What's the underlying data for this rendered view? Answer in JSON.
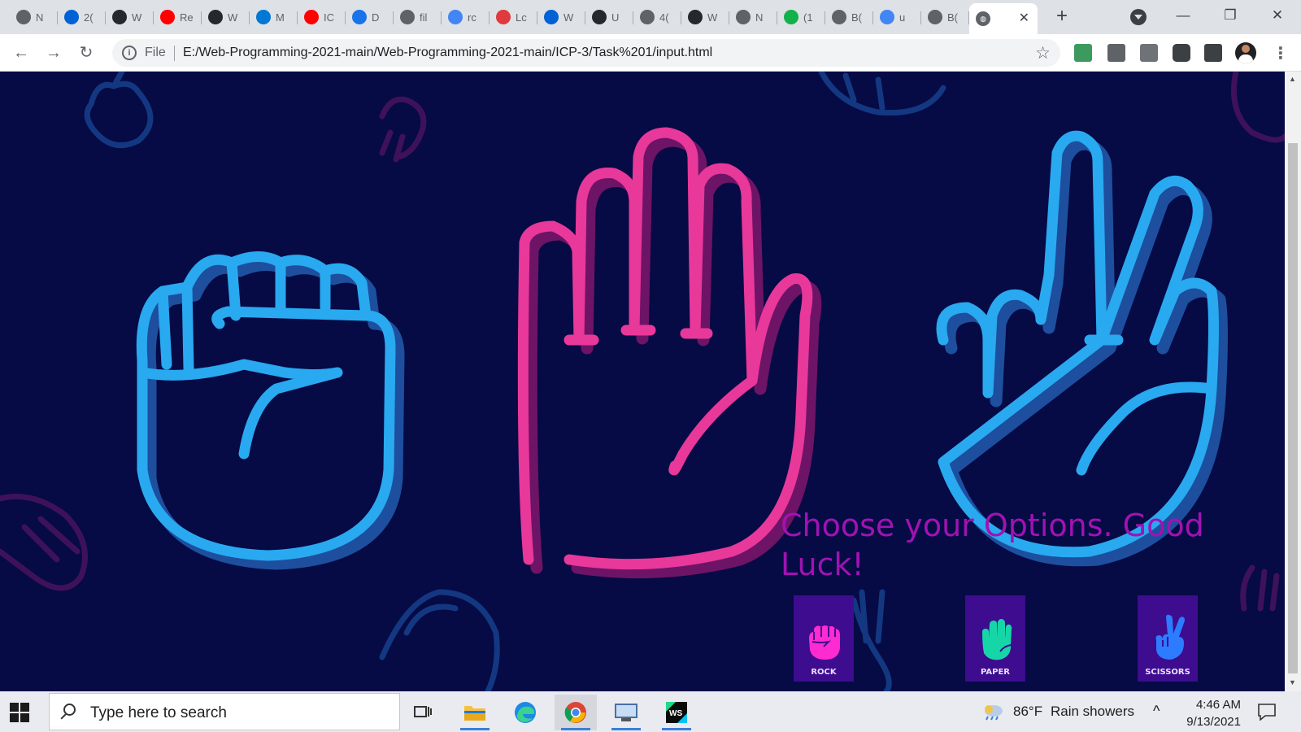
{
  "browser": {
    "tabs": [
      {
        "label": "N",
        "icon": "chrome-icon",
        "color": "#5f6368"
      },
      {
        "label": "2(",
        "icon": "box-icon",
        "color": "#0061d5"
      },
      {
        "label": "W",
        "icon": "github-icon",
        "color": "#24292e"
      },
      {
        "label": "Re",
        "icon": "youtube-icon",
        "color": "#ff0000"
      },
      {
        "label": "W",
        "icon": "github-icon",
        "color": "#24292e"
      },
      {
        "label": "M",
        "icon": "outlook-icon",
        "color": "#0078d4"
      },
      {
        "label": "IC",
        "icon": "youtube-icon",
        "color": "#ff0000"
      },
      {
        "label": "D",
        "icon": "download-icon",
        "color": "#1a73e8"
      },
      {
        "label": "fil",
        "icon": "globe-icon",
        "color": "#5f6368"
      },
      {
        "label": "rc",
        "icon": "google-icon",
        "color": "#4285f4"
      },
      {
        "label": "Lc",
        "icon": "flower-icon",
        "color": "#e03a3e"
      },
      {
        "label": "W",
        "icon": "box-icon",
        "color": "#0061d5"
      },
      {
        "label": "U",
        "icon": "github-icon",
        "color": "#24292e"
      },
      {
        "label": "4(",
        "icon": "globe-icon",
        "color": "#5f6368"
      },
      {
        "label": "W",
        "icon": "github-icon",
        "color": "#24292e"
      },
      {
        "label": "N",
        "icon": "chrome-icon",
        "color": "#5f6368"
      },
      {
        "label": "(1",
        "icon": "badge-icon",
        "color": "#12b14c"
      },
      {
        "label": "B(",
        "icon": "globe-icon",
        "color": "#5f6368"
      },
      {
        "label": "u",
        "icon": "google-icon",
        "color": "#4285f4"
      },
      {
        "label": "B(",
        "icon": "globe-icon",
        "color": "#5f6368"
      }
    ],
    "active_tab": {
      "label": "",
      "icon": "globe-icon"
    },
    "new_tab": "+",
    "window": {
      "minimize": "—",
      "restore": "❐",
      "close": "✕"
    },
    "address": {
      "scheme_label": "File",
      "url": "E:/Web-Programming-2021-main/Web-Programming-2021-main/ICP-3/Task%201/input.html"
    }
  },
  "page": {
    "heading": "Choose your Options. Good Luck!",
    "choices": [
      {
        "label": "ROCK",
        "icon": "rock-fist-icon",
        "color": "#ff2bd1"
      },
      {
        "label": "PAPER",
        "icon": "paper-hand-icon",
        "color": "#16d6a8"
      },
      {
        "label": "SCISSORS",
        "icon": "scissors-hand-icon",
        "color": "#2d7bff"
      }
    ],
    "colors": {
      "background": "#060a45",
      "rock": "#29a9f0",
      "paper": "#e8389a",
      "scissors": "#29a9f0",
      "heading": "#a112b3",
      "tile": "#3d0c8f"
    }
  },
  "taskbar": {
    "search_placeholder": "Type here to search",
    "weather": {
      "temp": "86°F",
      "condition": "Rain showers"
    },
    "time": "4:46 AM",
    "date": "9/13/2021"
  }
}
